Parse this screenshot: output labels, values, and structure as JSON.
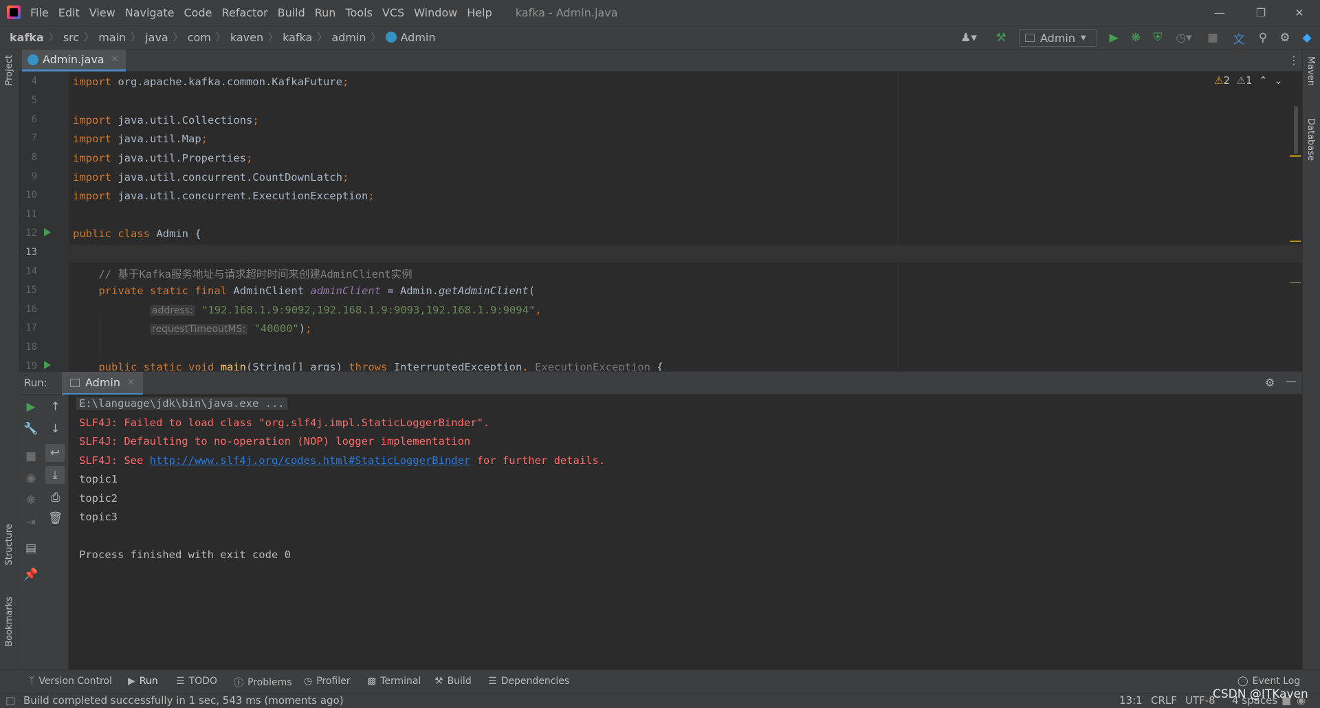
{
  "menubar": {
    "items": [
      "File",
      "Edit",
      "View",
      "Navigate",
      "Code",
      "Refactor",
      "Build",
      "Run",
      "Tools",
      "VCS",
      "Window",
      "Help"
    ],
    "window_title": "kafka - Admin.java",
    "controls": {
      "minimize": "—",
      "restore": "❐",
      "close": "✕"
    }
  },
  "breadcrumb": {
    "items": [
      "kafka",
      "src",
      "main",
      "java",
      "com",
      "kaven",
      "kafka",
      "admin",
      "Admin"
    ]
  },
  "toolbar": {
    "run_config": "Admin",
    "icons": [
      "user-icon",
      "hammer-icon",
      "run-icon",
      "debug-icon",
      "coverage-icon",
      "profile-icon",
      "stop-icon",
      "translate-icon",
      "search-icon",
      "settings-icon",
      "toolbox-icon"
    ]
  },
  "editor_tab": {
    "label": "Admin.java"
  },
  "side_tabs": {
    "left_top": "Project",
    "left_structure": "Structure",
    "left_bookmarks": "Bookmarks",
    "right_maven": "Maven",
    "right_database": "Database"
  },
  "inspections": {
    "warnings": "2",
    "weak_warnings": "1"
  },
  "editor": {
    "current_line": "13",
    "line_numbers": [
      "4",
      "5",
      "6",
      "7",
      "8",
      "9",
      "10",
      "11",
      "12",
      "13",
      "14",
      "15",
      "16",
      "17",
      "18",
      "19"
    ],
    "code": {
      "l4_path": "org.apache.kafka.common.KafkaFuture",
      "l6_path": "java.util.Collections",
      "l7_path": "java.util.Map",
      "l8_path": "java.util.Properties",
      "l9_path": "java.util.concurrent.CountDownLatch",
      "l10_path": "java.util.concurrent.ExecutionException",
      "kw_import": "import",
      "kw_public": "public",
      "kw_class": "class",
      "kw_private": "private",
      "kw_static": "static",
      "kw_final": "final",
      "kw_void": "void",
      "kw_throws": "throws",
      "class_name": "Admin",
      "comment": "// 基于Kafka服务地址与请求超时时间来创建AdminClient实例",
      "type_adminclient": "AdminClient",
      "field_adminclient": "adminClient",
      "method_get": "getAdminClient",
      "hint_address": "address:",
      "str_address": "\"192.168.1.9:9092,192.168.1.9:9093,192.168.1.9:9094\"",
      "hint_timeout": "requestTimeoutMS:",
      "str_timeout": "\"40000\"",
      "method_main": "main",
      "main_params": "(String[] args)",
      "ex_interrupted": "InterruptedException",
      "ex_execution": "ExecutionException"
    }
  },
  "run_window": {
    "label": "Run:",
    "tab": "Admin",
    "console": {
      "command": "E:\\language\\jdk\\bin\\java.exe ...",
      "err1": "SLF4J: Failed to load class \"org.slf4j.impl.StaticLoggerBinder\".",
      "err2": "SLF4J: Defaulting to no-operation (NOP) logger implementation",
      "err3_prefix": "SLF4J: See ",
      "err3_link": "http://www.slf4j.org/codes.html#StaticLoggerBinder",
      "err3_suffix": " for further details.",
      "out1": "topic1",
      "out2": "topic2",
      "out3": "topic3",
      "exit": "Process finished with exit code 0"
    }
  },
  "bottom_tabs": [
    "Version Control",
    "Run",
    "TODO",
    "Problems",
    "Profiler",
    "Terminal",
    "Build",
    "Dependencies"
  ],
  "event_log": "Event Log",
  "status_bar": {
    "message": "Build completed successfully in 1 sec, 543 ms (moments ago)",
    "position": "13:1",
    "line_sep": "CRLF",
    "encoding": "UTF-8",
    "indent": "4 spaces"
  },
  "watermark": "CSDN @ITKaven",
  "colors": {
    "keyword": "#cc7832",
    "string": "#6a8759",
    "field": "#9876aa",
    "method": "#ffc66d",
    "error": "#ff6b68",
    "link": "#287bde",
    "run_green": "#499c54",
    "accent": "#4a88c7"
  }
}
